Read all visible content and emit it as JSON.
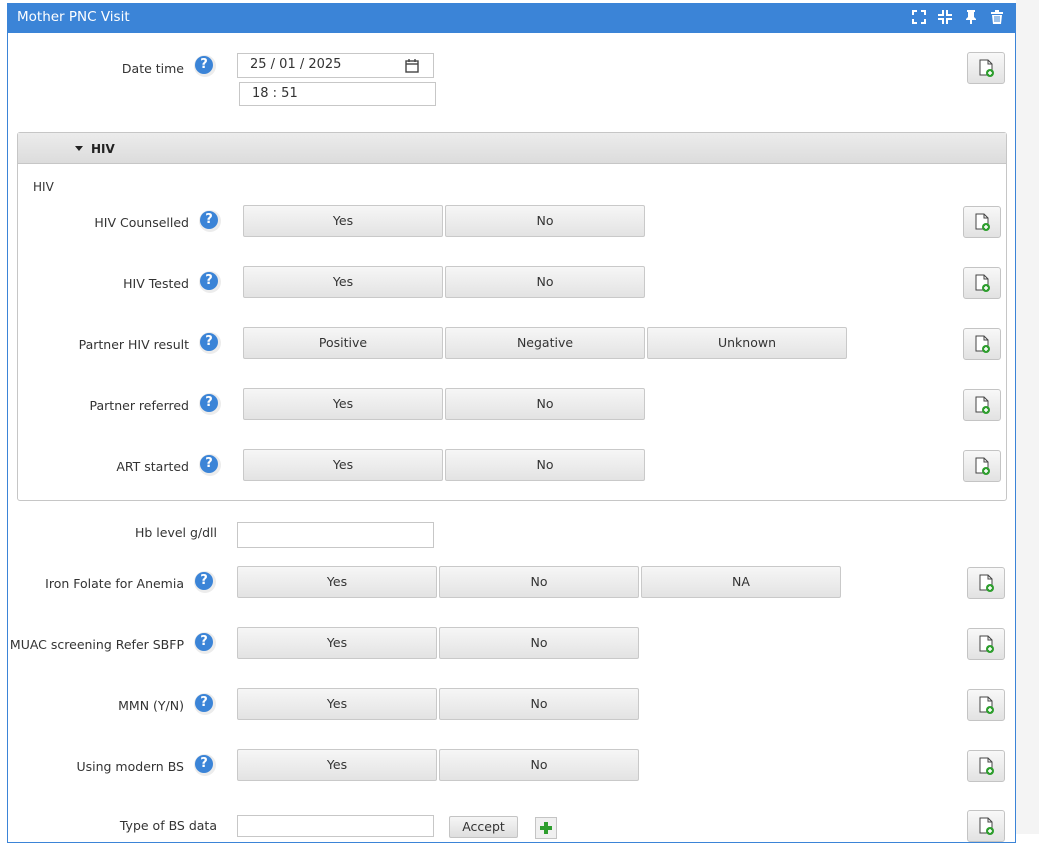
{
  "window": {
    "title": "Mother PNC Visit"
  },
  "header_icons": [
    "fullscreen-icon",
    "collapse-icon",
    "pin-icon",
    "trash-icon"
  ],
  "colors": {
    "accent": "#3b84d7",
    "add_icon_green": "#2e9e2e"
  },
  "datetime": {
    "label": "Date time",
    "date_value": "25 / 01 / 2025",
    "time_value": "18 : 51"
  },
  "hiv_section": {
    "header": "HIV",
    "subtitle": "HIV",
    "fields": [
      {
        "label": "HIV Counselled",
        "options": [
          "Yes",
          "No"
        ]
      },
      {
        "label": "HIV Tested",
        "options": [
          "Yes",
          "No"
        ]
      },
      {
        "label": "Partner HIV result",
        "options": [
          "Positive",
          "Negative",
          "Unknown"
        ]
      },
      {
        "label": "Partner referred",
        "options": [
          "Yes",
          "No"
        ]
      },
      {
        "label": "ART started",
        "options": [
          "Yes",
          "No"
        ]
      }
    ]
  },
  "hb": {
    "label": "Hb level g/dll",
    "value": ""
  },
  "fields": [
    {
      "label": "Iron Folate for Anemia",
      "options": [
        "Yes",
        "No",
        "NA"
      ]
    },
    {
      "label": "MUAC screening Refer SBFP",
      "options": [
        "Yes",
        "No"
      ]
    },
    {
      "label": "MMN (Y/N)",
      "options": [
        "Yes",
        "No"
      ]
    },
    {
      "label": "Using modern BS",
      "options": [
        "Yes",
        "No"
      ]
    }
  ],
  "bs_data": {
    "label": "Type of BS data",
    "value": "",
    "accept_label": "Accept"
  },
  "help_glyph": "?"
}
